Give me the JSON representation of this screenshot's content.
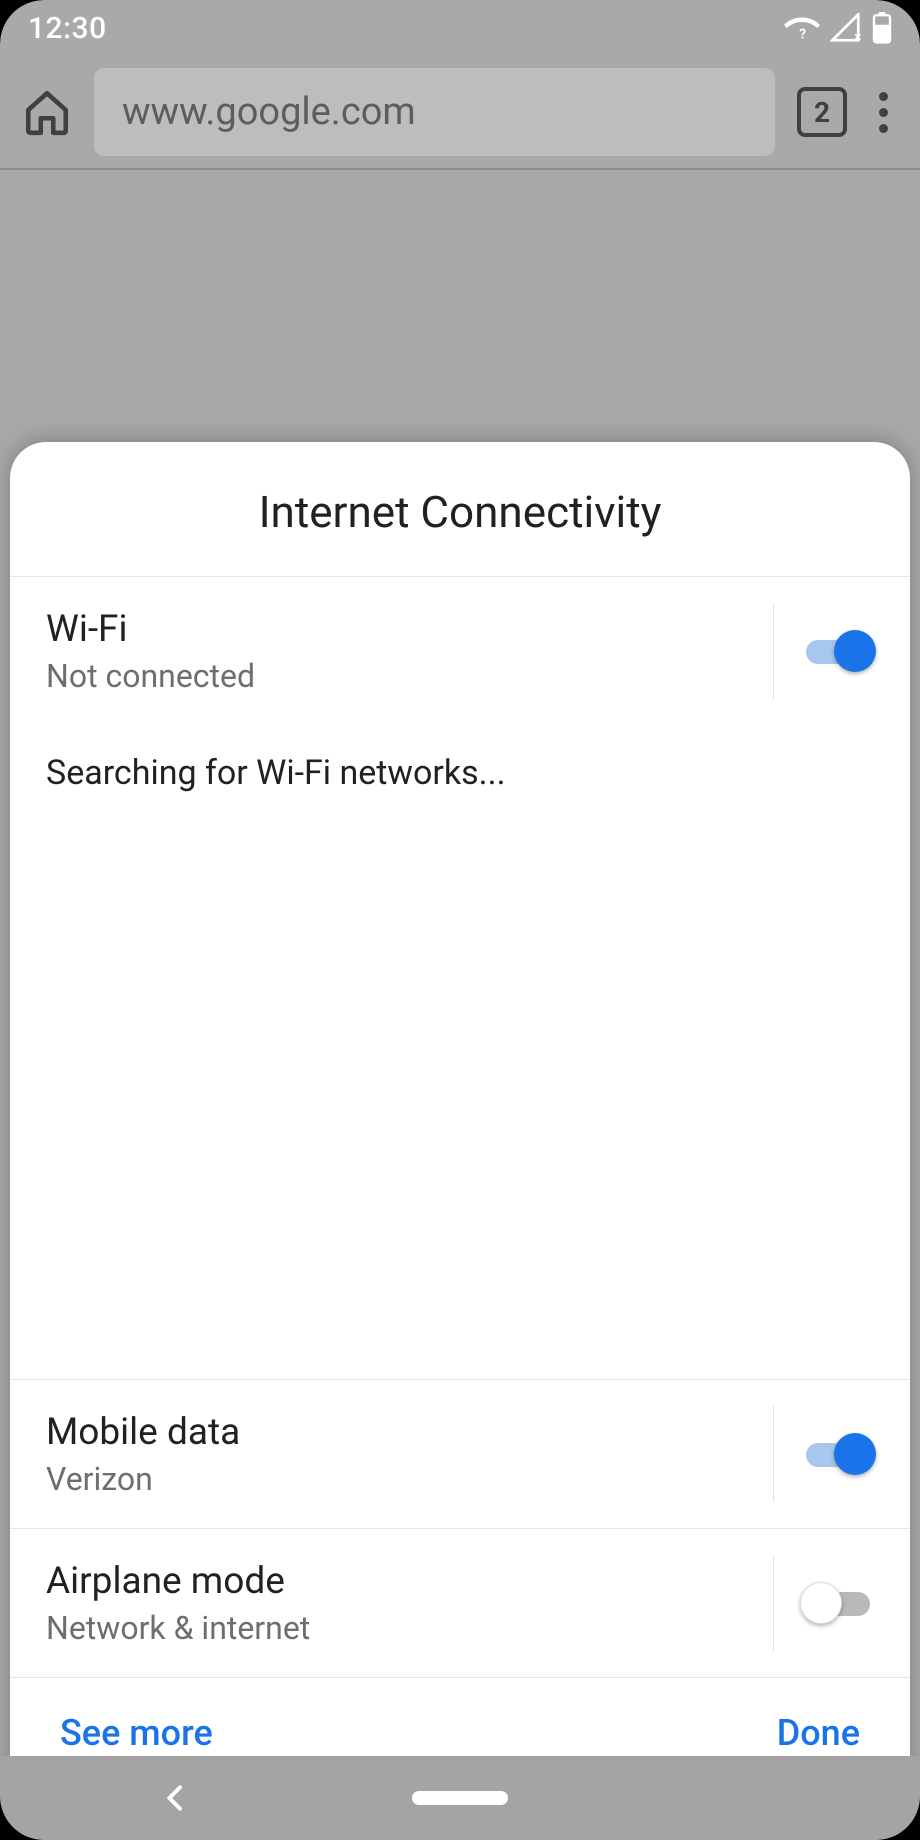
{
  "status": {
    "time": "12:30"
  },
  "browser": {
    "url": "www.google.com",
    "tab_count": "2"
  },
  "sheet": {
    "title": "Internet Connectivity",
    "wifi": {
      "title": "Wi-Fi",
      "sub": "Not connected",
      "searching": "Searching for Wi-Fi networks...",
      "on": true
    },
    "mobile": {
      "title": "Mobile data",
      "sub": "Verizon",
      "on": true
    },
    "airplane": {
      "title": "Airplane mode",
      "sub": "Network & internet",
      "on": false
    },
    "actions": {
      "see_more": "See more",
      "done": "Done"
    }
  }
}
